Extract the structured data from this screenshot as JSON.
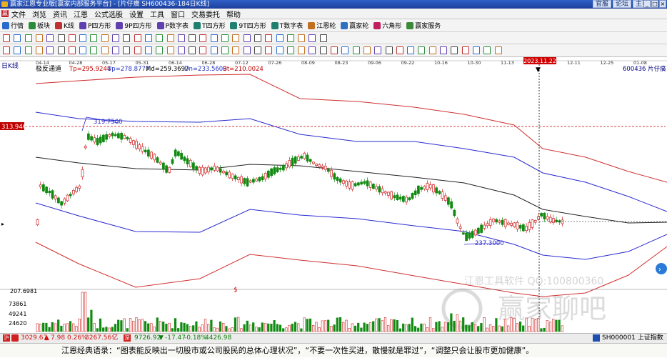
{
  "window": {
    "title": "赢家江恩专业版[赢家内部服务平台] - [片仔癀  SH600436-184日K线]",
    "links": [
      "官服",
      "论坛",
      "主页"
    ]
  },
  "menu": [
    "文件",
    "浏览",
    "资讯",
    "江恩",
    "公式选股",
    "设置",
    "工具",
    "窗口",
    "交易委托",
    "帮助"
  ],
  "toolbar": [
    {
      "icon": "grid-icon",
      "label": "行情",
      "color": "#2a6ccc"
    },
    {
      "icon": "board-icon",
      "label": "板块",
      "color": "#2a8c3a"
    },
    {
      "icon": "kline-icon",
      "label": "K线",
      "color": "#c03030"
    },
    {
      "icon": "square-icon",
      "label": "P四方形",
      "color": "#6040b0"
    },
    {
      "icon": "square-9-icon",
      "label": "9P四方形",
      "color": "#6040b0"
    },
    {
      "icon": "table-icon",
      "label": "P数字表",
      "color": "#6040b0"
    },
    {
      "icon": "square-t-icon",
      "label": "T四方形",
      "color": "#208070"
    },
    {
      "icon": "square-9t-icon",
      "label": "9T四方形",
      "color": "#208070"
    },
    {
      "icon": "table-t-icon",
      "label": "T数字表",
      "color": "#208070"
    },
    {
      "icon": "wheel-icon",
      "label": "江恩轮",
      "color": "#c07020"
    },
    {
      "icon": "winner-wheel-icon",
      "label": "赢家轮",
      "color": "#3070c0"
    },
    {
      "icon": "hexagon-icon",
      "label": "六角形",
      "color": "#c02060"
    },
    {
      "icon": "service-icon",
      "label": "赢家服务",
      "color": "#3a8a3a"
    }
  ],
  "chart": {
    "period_label": "日K线",
    "indicator": "极反通道",
    "tp": "Tp=295.9244",
    "up": "Up=278.8777",
    "md": "Md=259.3697",
    "dn": "Dn=233.5609",
    "bt": "Bt=210.0024",
    "symbol": "600436 片仔癀",
    "cursor_date": "2023.11.22",
    "price_marker": "313.9461",
    "price_marker_color": "#c00000",
    "high_annotation": "319.7500",
    "low_annotation": "237.3000",
    "dates": [
      "04-14",
      "04-28",
      "05-17",
      "05-31",
      "06-14",
      "06-28",
      "07-12",
      "07-26",
      "08-09",
      "08-23",
      "09-06",
      "09-22",
      "10-16",
      "10-30",
      "11-13",
      "11-27",
      "12-11",
      "12-25",
      "01-08"
    ],
    "volume_top": "207.6981",
    "volume_ticks": [
      "73861",
      "49241",
      "24620"
    ],
    "watermark_main": "江恩工具软件 QQ:100800360",
    "watermark_brand": "赢家聊吧"
  },
  "status": {
    "sh_index": "3029.67",
    "sh_change": "7.98",
    "sh_pct": "0.26%",
    "sh_amount": "3267.56亿",
    "sz_index": "9726.92",
    "sz_change": "-17.47",
    "sz_pct": "-0.18%",
    "sz_amount": "4426.98",
    "right_label": "SH000001 上证指数"
  },
  "ticker": "江恩经典语录：“图表能反映出一切股市或公司股民的总体心理状况”，“不要一次性买进，散慢就是罪过”，“调整只会让股市更加健康”。"
}
